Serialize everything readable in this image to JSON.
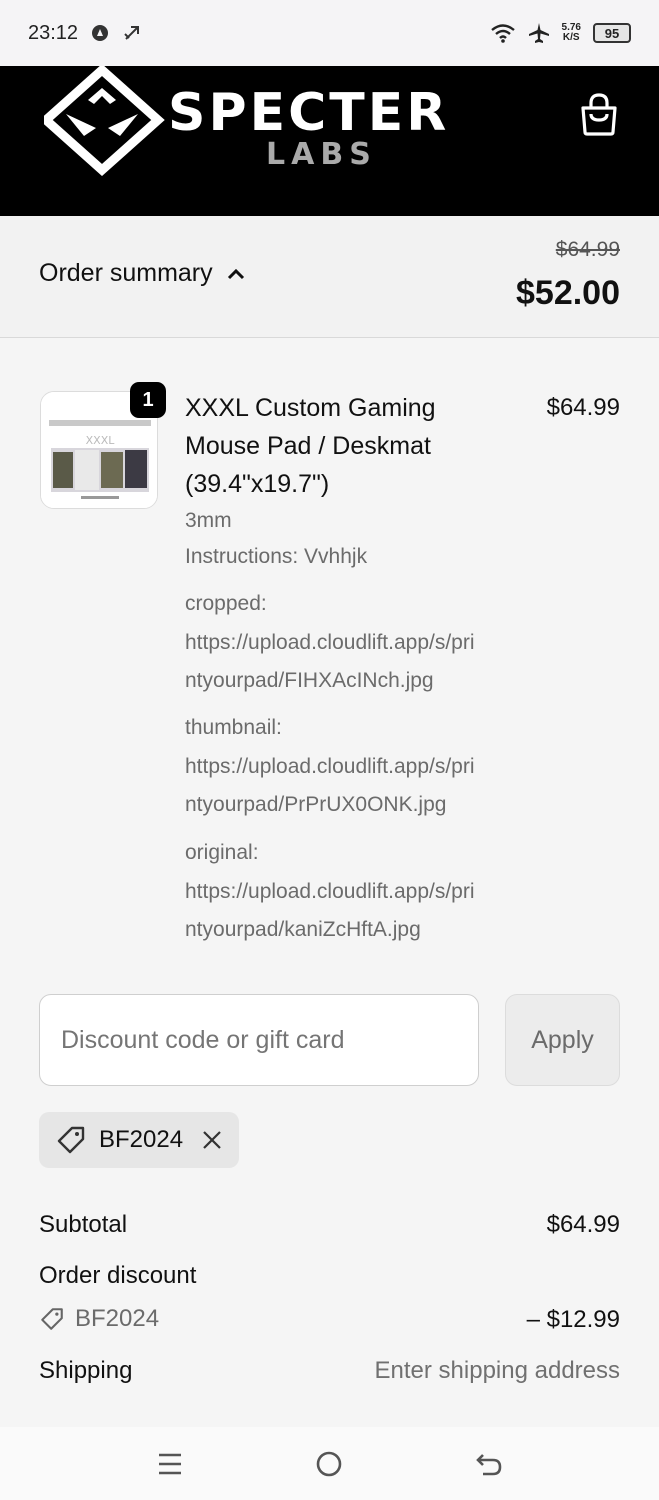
{
  "status_bar": {
    "time": "23:12",
    "net_speed_value": "5.76",
    "net_speed_unit": "K/S",
    "battery": "95",
    "icons": [
      "notification-icon",
      "assist-icon",
      "wifi-icon",
      "airplane-icon",
      "battery-icon"
    ]
  },
  "header": {
    "brand_main": "SPECTER",
    "brand_sub": "LABS",
    "cart_icon": "shopping-bag-icon"
  },
  "summary": {
    "toggle_label": "Order summary",
    "old_total": "$64.99",
    "total": "$52.00"
  },
  "item": {
    "quantity": "1",
    "title_line1": "XXXL Custom Gaming",
    "title_line2": "Mouse Pad / Deskmat",
    "title_line3": "(39.4\"x19.7\")",
    "price": "$64.99",
    "variant": "3mm",
    "instructions": "Instructions: Vvhhjk",
    "cropped_label": "cropped:",
    "cropped_line1": "https://upload.cloudlift.app/s/pri",
    "cropped_line2": "ntyourpad/FIHXAcINch.jpg",
    "thumbnail_label": "thumbnail:",
    "thumbnail_line1": "https://upload.cloudlift.app/s/pri",
    "thumbnail_line2": "ntyourpad/PrPrUX0ONK.jpg",
    "original_label": "original:",
    "original_line1": "https://upload.cloudlift.app/s/pri",
    "original_line2": "ntyourpad/kaniZcHftA.jpg",
    "thumb_text": "XXXL"
  },
  "discount": {
    "placeholder": "Discount code or gift card",
    "apply_label": "Apply",
    "applied_code": "BF2024"
  },
  "totals": {
    "subtotal_label": "Subtotal",
    "subtotal_value": "$64.99",
    "order_discount_label": "Order discount",
    "discount_code": "BF2024",
    "discount_value": "– $12.99",
    "shipping_label": "Shipping",
    "shipping_value": "Enter shipping address"
  },
  "colors": {
    "header_bg": "#000000",
    "page_bg": "#f5f5f5",
    "text": "#111111",
    "muted": "#6b6b6b"
  }
}
